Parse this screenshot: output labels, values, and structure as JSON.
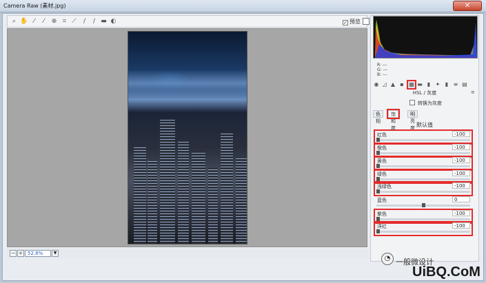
{
  "window": {
    "title": "Camera Raw (素材.jpg)",
    "close_label": "✕"
  },
  "toolbar": {
    "tools": [
      "zoom-icon",
      "hand-icon",
      "white-balance-icon",
      "color-sampler-icon",
      "target-adjust-icon",
      "crop-icon",
      "straighten-icon",
      "spot-removal-icon",
      "red-eye-icon",
      "adjustment-brush-icon",
      "graduated-filter-icon",
      "radial-filter-icon"
    ],
    "preview_label": "预览"
  },
  "statusbar": {
    "zoom_value": "52.8%"
  },
  "histogram": {
    "r_label": "R: ---",
    "g_label": "G: ---",
    "b_label": "B: ---"
  },
  "panel": {
    "section_title": "HSL / 灰度",
    "convert_grayscale": "转换为灰度",
    "subtabs": [
      "色相",
      "饱和度",
      "明亮度"
    ],
    "defaults_label": "默认值",
    "sliders": [
      {
        "label": "红色",
        "value": "-100",
        "fraction": 0.0,
        "highlighted": true
      },
      {
        "label": "橙色",
        "value": "-100",
        "fraction": 0.0,
        "highlighted": true
      },
      {
        "label": "黄色",
        "value": "-100",
        "fraction": 0.0,
        "highlighted": true
      },
      {
        "label": "绿色",
        "value": "-100",
        "fraction": 0.0,
        "highlighted": true
      },
      {
        "label": "浅绿色",
        "value": "-100",
        "fraction": 0.0,
        "highlighted": true
      },
      {
        "label": "蓝色",
        "value": "0",
        "fraction": 0.5,
        "highlighted": false
      },
      {
        "label": "紫色",
        "value": "-100",
        "fraction": 0.0,
        "highlighted": true
      },
      {
        "label": "洋红",
        "value": "-100",
        "fraction": 0.0,
        "highlighted": true
      }
    ]
  },
  "watermark": {
    "text": "一般微设计",
    "brand": "UiBQ.CoM"
  }
}
